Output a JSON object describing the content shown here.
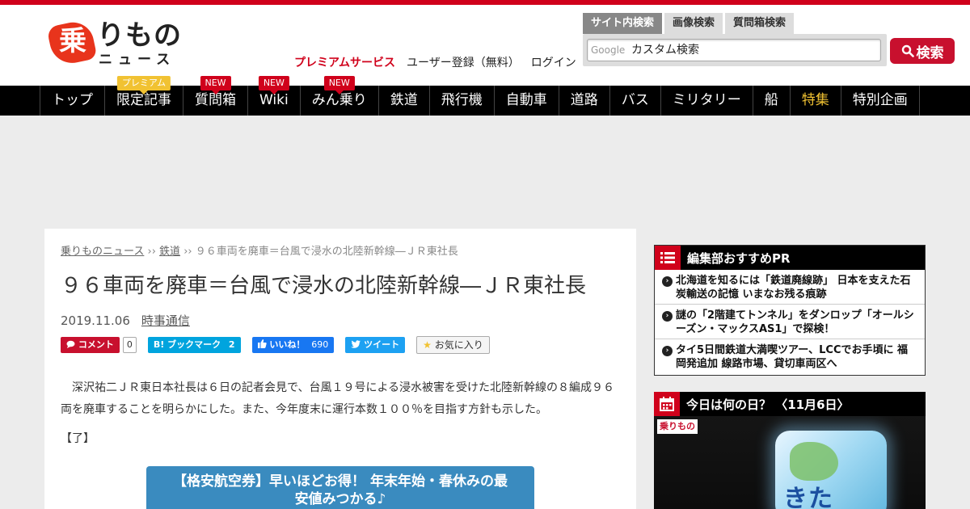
{
  "colors": {
    "brand_red": "#d0011b",
    "nav_bg": "#000000",
    "feature_yellow": "#f1c232",
    "search_button": "#c8102e",
    "ad_blue": "#3a8bbf"
  },
  "logo": {
    "badge": "乗",
    "main": "りもの",
    "sub": "ニュース"
  },
  "header_links": {
    "premium": "プレミアムサービス",
    "register": "ユーザー登録（無料）",
    "login": "ログイン"
  },
  "search": {
    "tabs": [
      "サイト内検索",
      "画像検索",
      "質問箱検索"
    ],
    "brand": "Google",
    "placeholder": "カスタム検索",
    "button_label": "検索",
    "button_icon": "search-icon"
  },
  "nav": {
    "items": [
      {
        "label": "トップ"
      },
      {
        "label": "限定記事",
        "badge": "プレミアム"
      },
      {
        "label": "質問箱",
        "badge": "NEW"
      },
      {
        "label": "Wiki",
        "badge": "NEW"
      },
      {
        "label": "みん乗り",
        "badge": "NEW"
      },
      {
        "label": "鉄道"
      },
      {
        "label": "飛行機"
      },
      {
        "label": "自動車"
      },
      {
        "label": "道路"
      },
      {
        "label": "バス"
      },
      {
        "label": "ミリタリー"
      },
      {
        "label": "船"
      },
      {
        "label": "特集"
      },
      {
        "label": "特別企画"
      }
    ]
  },
  "article": {
    "breadcrumb": {
      "home": "乗りものニュース",
      "sep": "››",
      "category": "鉄道",
      "current": "９６車両を廃車＝台風で浸水の北陸新幹線―ＪＲ東社長"
    },
    "title": "９６車両を廃車＝台風で浸水の北陸新幹線―ＪＲ東社長",
    "date": "2019.11.06",
    "source": "時事通信",
    "share": {
      "comment_label": "コメント",
      "comment_count": "0",
      "hatena_label": "B! ブックマーク",
      "hatena_count": "2",
      "fb_label": "いいね！",
      "fb_count": "690",
      "tw_label": "ツイート",
      "fav_label": "お気に入り",
      "fav_icon": "star-icon"
    },
    "body": "　深沢祐二ＪＲ東日本社長は６日の記者会見で、台風１９号による浸水被害を受けた北陸新幹線の８編成９６両を廃車することを明らかにした。また、今年度末に運行本数１００％を目指す方針も示した。",
    "end_mark": "【了】",
    "ad_text_1": "【格安航空券】早いほどお得！ 年末年始・春休みの最",
    "ad_text_2": "安値みつかる♪"
  },
  "sidebar": {
    "pr": {
      "title": "編集部おすすめPR",
      "icon": "list-icon",
      "items": [
        "北海道を知るには「鉄道廃線跡」 日本を支えた石炭輸送の記憶 いまなお残る痕跡",
        "謎の「2階建てトンネル」をダンロップ「オールシーズン・マックスAS1」で探検！",
        "タイ5日間鉄道大満喫ツアー、LCCでお手頃に 福岡発追加 線路市場、貸切車両区へ"
      ]
    },
    "today": {
      "title": "今日は何の日？ 〈11月6日〉",
      "icon": "calendar-icon",
      "watermark_red": "乗りもの",
      "sign_text": "きた"
    }
  }
}
